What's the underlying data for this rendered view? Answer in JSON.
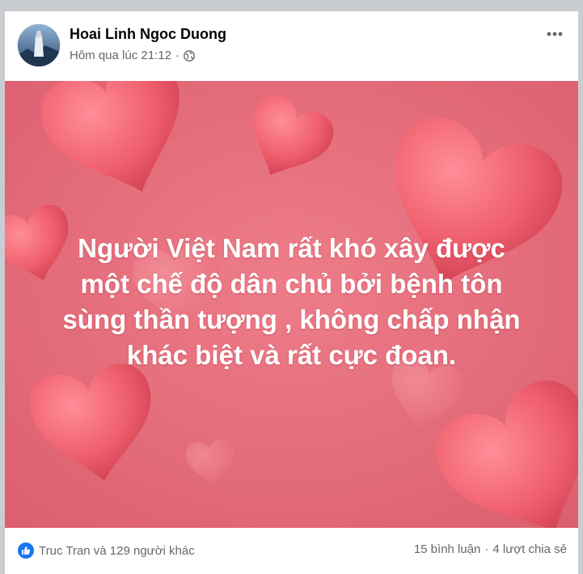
{
  "post": {
    "author": "Hoai Linh Ngoc Duong",
    "timestamp": "Hôm qua lúc 21:12",
    "separator": "·",
    "privacy_icon": "globe-icon",
    "more_icon": "more-options-icon",
    "text_lines": [
      "Người Việt Nam rất khó xây được",
      "một chế độ dân chủ bởi bệnh tôn",
      "sùng thần tượng , không chấp nhận",
      "khác biệt và rất cực đoan."
    ],
    "background_color": "#e7707e",
    "heart_color": "#f0606e"
  },
  "footer": {
    "reactions_text": "Truc Tran và 129 người khác",
    "reaction_icon": "like-icon",
    "like_color": "#1877f2",
    "comments": "15 bình luận",
    "separator": "·",
    "shares": "4 lượt chia sẻ"
  }
}
